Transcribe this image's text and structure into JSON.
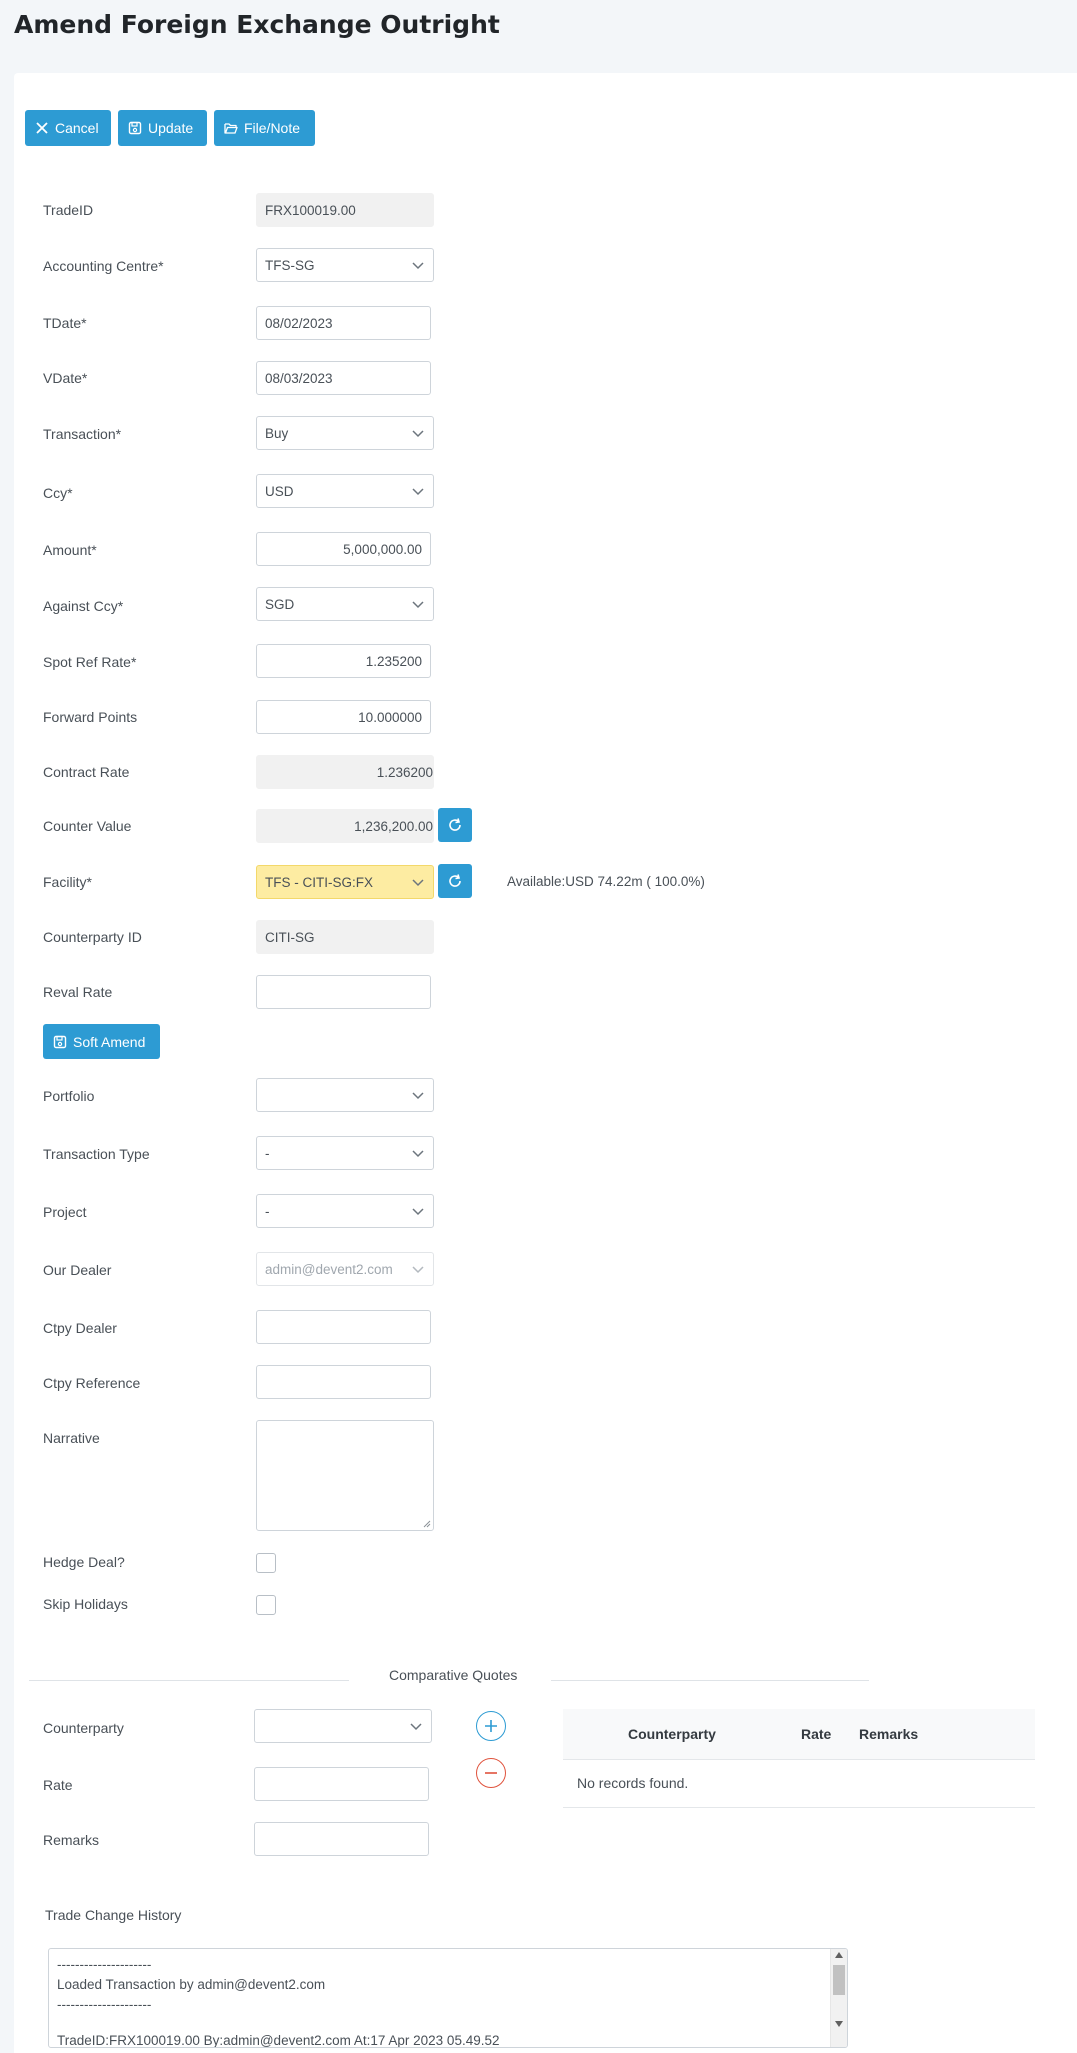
{
  "page": {
    "title": "Amend Foreign Exchange Outright"
  },
  "toolbar": {
    "cancel": "Cancel",
    "update": "Update",
    "file_note": "File/Note"
  },
  "fields": {
    "trade_id": {
      "label": "TradeID",
      "value": "FRX100019.00"
    },
    "accounting_centre": {
      "label": "Accounting Centre*",
      "value": "TFS-SG"
    },
    "tdate": {
      "label": "TDate*",
      "value": "08/02/2023"
    },
    "vdate": {
      "label": "VDate*",
      "value": "08/03/2023"
    },
    "transaction": {
      "label": "Transaction*",
      "value": "Buy"
    },
    "ccy": {
      "label": "Ccy*",
      "value": "USD"
    },
    "amount": {
      "label": "Amount*",
      "value": "5,000,000.00"
    },
    "against_ccy": {
      "label": "Against Ccy*",
      "value": "SGD"
    },
    "spot_ref_rate": {
      "label": "Spot Ref Rate*",
      "value": "1.235200"
    },
    "forward_points": {
      "label": "Forward Points",
      "value": "10.000000"
    },
    "contract_rate": {
      "label": "Contract Rate",
      "value": "1.236200"
    },
    "counter_value": {
      "label": "Counter Value",
      "value": "1,236,200.00"
    },
    "facility": {
      "label": "Facility*",
      "value": "TFS - CITI-SG:FX",
      "available": "Available:USD 74.22m ( 100.0%)"
    },
    "counterparty_id": {
      "label": "Counterparty ID",
      "value": "CITI-SG"
    },
    "reval_rate": {
      "label": "Reval Rate",
      "value": ""
    },
    "soft_amend": "Soft Amend",
    "portfolio": {
      "label": "Portfolio",
      "value": ""
    },
    "transaction_type": {
      "label": "Transaction Type",
      "value": "-"
    },
    "project": {
      "label": "Project",
      "value": "-"
    },
    "our_dealer": {
      "label": "Our Dealer",
      "value": "admin@devent2.com"
    },
    "ctpy_dealer": {
      "label": "Ctpy Dealer",
      "value": ""
    },
    "ctpy_reference": {
      "label": "Ctpy Reference",
      "value": ""
    },
    "narrative": {
      "label": "Narrative",
      "value": ""
    },
    "hedge_deal": {
      "label": "Hedge Deal?"
    },
    "skip_holidays": {
      "label": "Skip Holidays"
    }
  },
  "quotes": {
    "title": "Comparative Quotes",
    "counterparty_label": "Counterparty",
    "rate_label": "Rate",
    "remarks_label": "Remarks",
    "columns": [
      "Counterparty",
      "Rate",
      "Remarks"
    ],
    "empty_message": "No records found."
  },
  "history": {
    "title": "Trade Change History",
    "lines": [
      "---------------------",
      "Loaded Transaction by admin@devent2.com",
      "---------------------",
      "",
      "TradeID:FRX100019.00 By:admin@devent2.com At:17 Apr 2023 05.49.52"
    ]
  },
  "colors": {
    "accent": "#2d9bd3",
    "facility_bg": "#fdeca2",
    "remove": "#e0533d"
  }
}
